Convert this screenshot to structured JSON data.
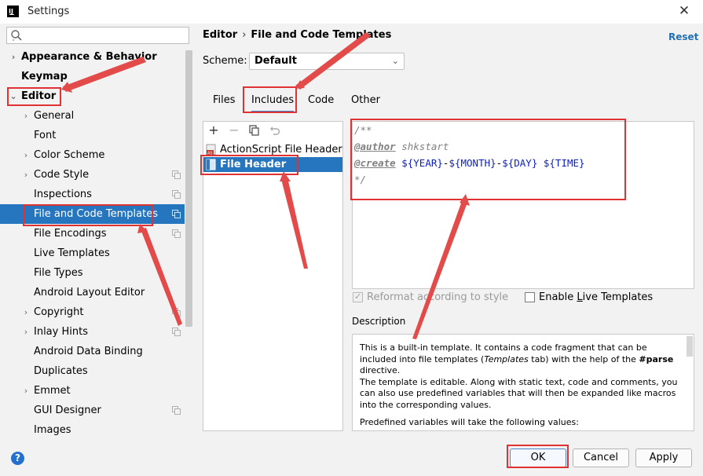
{
  "window": {
    "title": "Settings",
    "app_icon": "intellij-icon",
    "close_label": "✕"
  },
  "search": {
    "placeholder": "",
    "value": ""
  },
  "sidebar": {
    "items": [
      {
        "label": "Appearance & Behavior",
        "arrow": "›",
        "bold": true
      },
      {
        "label": "Keymap",
        "arrow": "",
        "bold": true
      },
      {
        "label": "Editor",
        "arrow": "⌄",
        "bold": true
      },
      {
        "label": "General",
        "arrow": "›"
      },
      {
        "label": "Font",
        "arrow": ""
      },
      {
        "label": "Color Scheme",
        "arrow": "›"
      },
      {
        "label": "Code Style",
        "arrow": "›",
        "project": true
      },
      {
        "label": "Inspections",
        "arrow": "",
        "project": true
      },
      {
        "label": "File and Code Templates",
        "arrow": "",
        "project": true,
        "selected": true
      },
      {
        "label": "File Encodings",
        "arrow": "",
        "project": true
      },
      {
        "label": "Live Templates",
        "arrow": ""
      },
      {
        "label": "File Types",
        "arrow": ""
      },
      {
        "label": "Android Layout Editor",
        "arrow": ""
      },
      {
        "label": "Copyright",
        "arrow": "›",
        "project": true
      },
      {
        "label": "Inlay Hints",
        "arrow": "›",
        "project": true
      },
      {
        "label": "Android Data Binding",
        "arrow": ""
      },
      {
        "label": "Duplicates",
        "arrow": ""
      },
      {
        "label": "Emmet",
        "arrow": "›"
      },
      {
        "label": "GUI Designer",
        "arrow": "",
        "project": true
      },
      {
        "label": "Images",
        "arrow": ""
      }
    ]
  },
  "main": {
    "breadcrumb": {
      "part1": "Editor",
      "separator": "›",
      "part2": "File and Code Templates"
    },
    "reset_label": "Reset",
    "scheme": {
      "label": "Scheme:",
      "value": "Default"
    },
    "tabs": [
      {
        "label": "Files"
      },
      {
        "label": "Includes",
        "active": true
      },
      {
        "label": "Code"
      },
      {
        "label": "Other"
      }
    ],
    "toolbar": {
      "add": "+",
      "remove": "−",
      "copy": "copy-icon",
      "reset": "undo-icon"
    },
    "templates": [
      {
        "label": "ActionScript File Header",
        "icon": "actionscript-file-icon"
      },
      {
        "label": "File Header",
        "icon": "file-header-icon",
        "selected": true
      }
    ],
    "editor": {
      "line1": "/**",
      "line2_tag": "@author",
      "line2_text": " shkstart",
      "line3_tag": "@create",
      "line3_var1": "${YEAR}",
      "line3_dash1": "-",
      "line3_var2": "${MONTH}",
      "line3_dash2": "-",
      "line3_var3": "${DAY}",
      "line3_space": " ",
      "line3_var4": "${TIME}",
      "line4": "*/"
    },
    "reformat": {
      "label": "Reformat according to style",
      "checked": true,
      "enabled": false
    },
    "live_templates": {
      "label_pre": "Enable ",
      "label_u": "L",
      "label_post": "ive Templates",
      "checked": false
    },
    "description": {
      "label": "Description",
      "p1_a": "This is a built-in template. It contains a code fragment that can be included into file templates (",
      "p1_em": "Templates",
      "p1_b": " tab) with the help of the ",
      "p1_code": "#parse",
      "p1_c": " directive.",
      "p2": "The template is editable. Along with static text, code and comments, you can also use predefined variables that will then be expanded like macros into the corresponding values.",
      "p3": "Predefined variables will take the following values:"
    }
  },
  "buttons": {
    "ok": "OK",
    "cancel": "Cancel",
    "apply": "Apply",
    "help": "?"
  },
  "colors": {
    "selection": "#2675bf",
    "link": "#2470b3",
    "annotation": "#e03232",
    "template_var": "#0d1ebf"
  }
}
